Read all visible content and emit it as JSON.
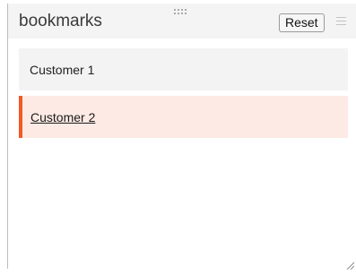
{
  "panel": {
    "title": "bookmarks",
    "reset_label": "Reset"
  },
  "bookmarks": [
    {
      "label": "Customer 1",
      "active": false
    },
    {
      "label": "Customer 2",
      "active": true
    }
  ],
  "colors": {
    "accent": "#f15a22",
    "active_bg": "#fdeae4",
    "item_bg": "#f3f3f3",
    "header_bg": "#f4f4f4"
  },
  "icons": {
    "drag": "drag-handle-icon",
    "menu": "menu-icon",
    "resize": "resize-grip-icon"
  }
}
